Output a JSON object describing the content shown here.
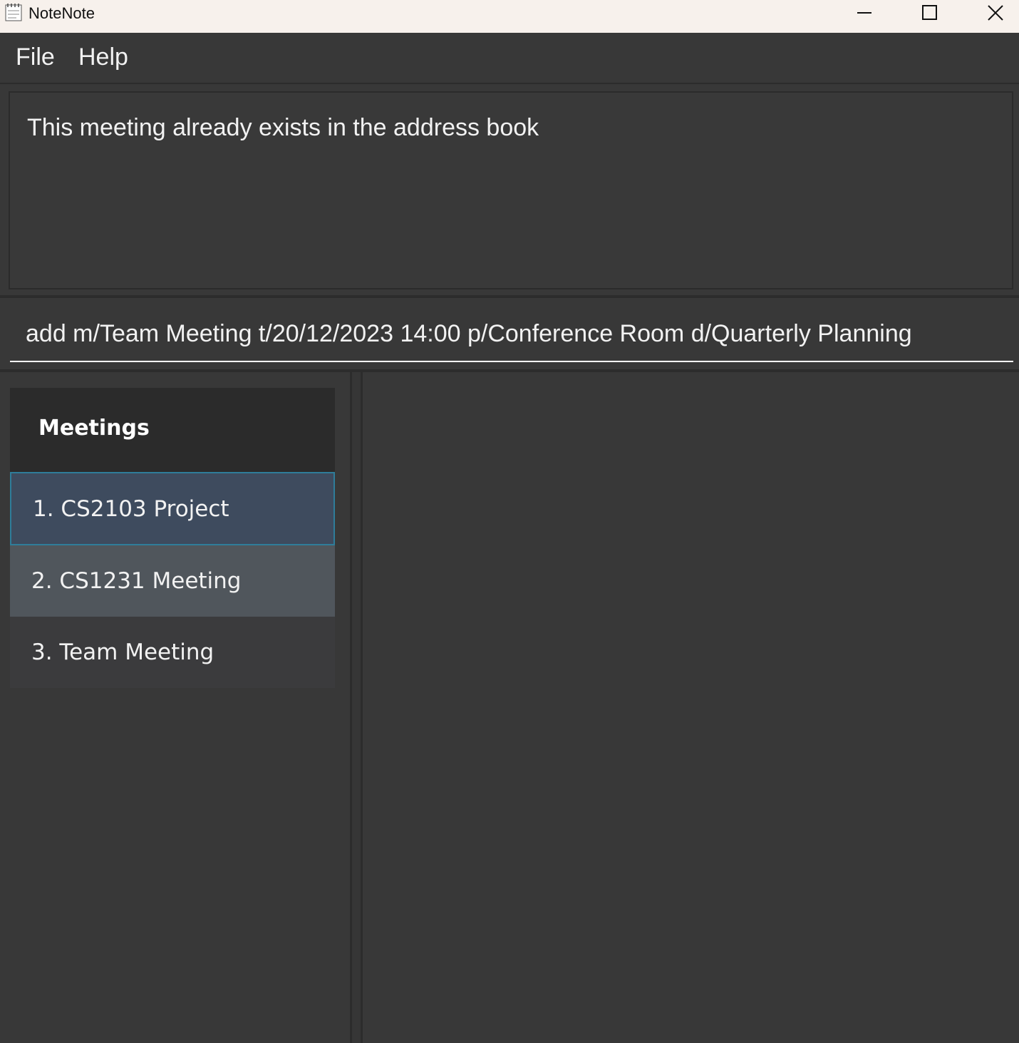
{
  "window": {
    "title": "NoteNote",
    "icon": "note-app-icon"
  },
  "window_controls": {
    "minimize_icon": "minimize-icon",
    "maximize_icon": "maximize-icon",
    "close_icon": "close-icon"
  },
  "menu": {
    "items": [
      {
        "label": "File"
      },
      {
        "label": "Help"
      }
    ]
  },
  "result": {
    "message": "This meeting already exists in the address book"
  },
  "command": {
    "value": "add m/Team Meeting t/20/12/2023 14:00 p/Conference Room d/Quarterly Planning"
  },
  "meetings": {
    "header": "Meetings",
    "items": [
      {
        "label": "1.  CS2103 Project",
        "state": "selected"
      },
      {
        "label": "2.  CS1231 Meeting",
        "state": "hover"
      },
      {
        "label": "3.  Team Meeting",
        "state": "normal"
      }
    ]
  },
  "colors": {
    "background": "#383838",
    "titlebar": "#f7f1ec",
    "list_header": "#2b2b2b",
    "selected_item": "#3e4b5e",
    "selected_border": "#2f7d9a",
    "hover_item": "#50565c",
    "text": "#f2f2f2"
  }
}
